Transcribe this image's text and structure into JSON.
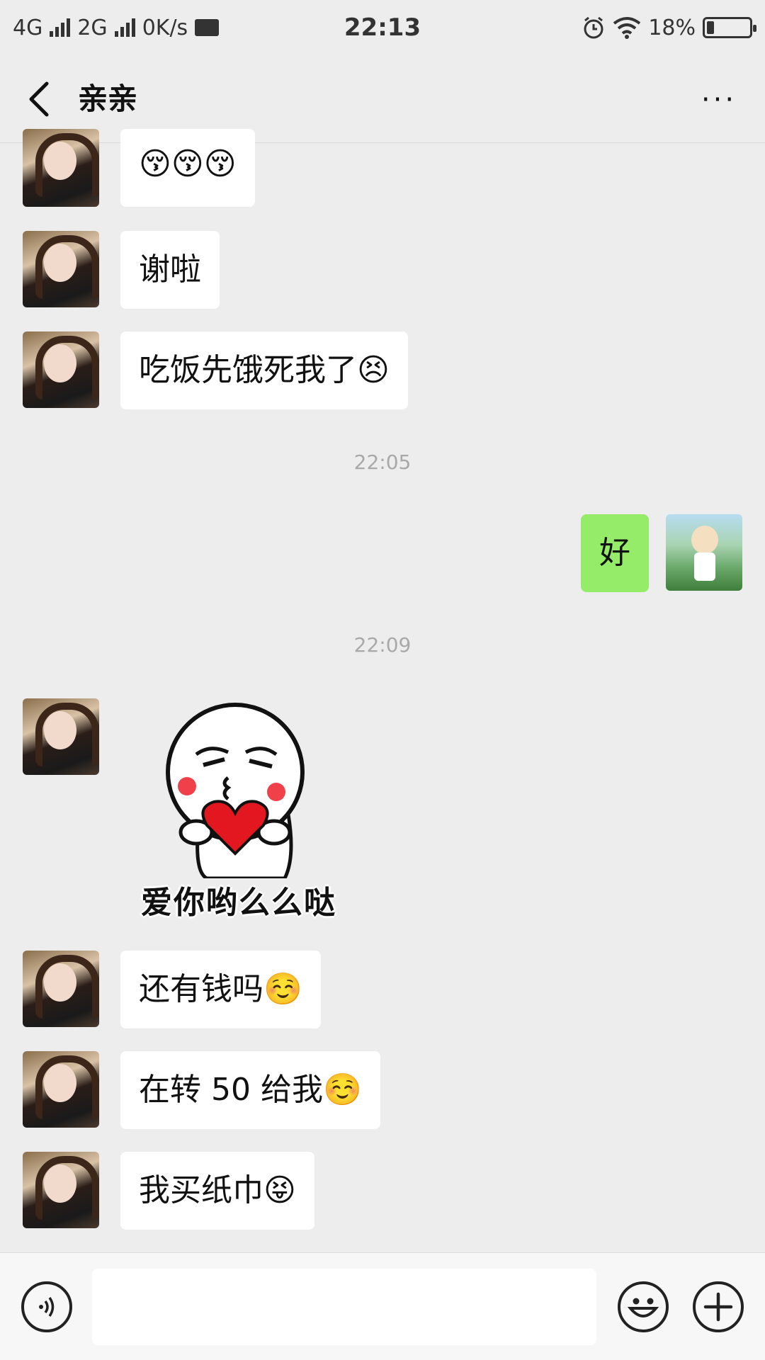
{
  "status_bar": {
    "network1": "4G",
    "network2": "2G",
    "speed": "0K/s",
    "time": "22:13",
    "battery": "18%"
  },
  "header": {
    "title": "亲亲",
    "more": "···"
  },
  "messages": [
    {
      "from": "her",
      "text": "😚😚😚"
    },
    {
      "from": "her",
      "text": "谢啦"
    },
    {
      "from": "her",
      "text": "吃饭先饿死我了😣"
    },
    {
      "type": "time",
      "text": "22:05"
    },
    {
      "from": "me",
      "text": "好"
    },
    {
      "type": "time",
      "text": "22:09"
    },
    {
      "from": "her",
      "type": "sticker",
      "caption": "爱你哟么么哒"
    },
    {
      "from": "her",
      "text": "还有钱吗☺️"
    },
    {
      "from": "her",
      "text": "在转 50 给我☺️"
    },
    {
      "from": "her",
      "text": "我买纸巾😝"
    }
  ],
  "input": {
    "value": "",
    "placeholder": ""
  },
  "icons": {
    "back": "chevron-left-icon",
    "more": "more-dots-icon",
    "voice": "voice-icon",
    "emoji": "emoji-icon",
    "plus": "plus-icon"
  },
  "colors": {
    "background": "#ededed",
    "my_bubble": "#95ec69",
    "her_bubble": "#ffffff",
    "timestamp": "#a9a9a9"
  }
}
